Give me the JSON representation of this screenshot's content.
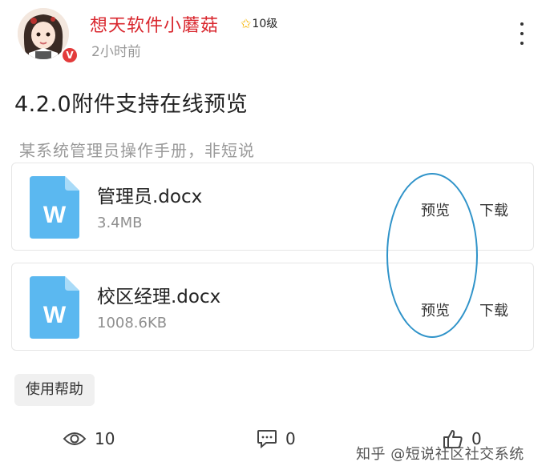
{
  "header": {
    "username": "想天软件小蘑菇",
    "level": "10级",
    "time_ago": "2小时前",
    "verified_mark": "V"
  },
  "post": {
    "title": "4.2.0附件支持在线预览",
    "description": "某系统管理员操作手册，非短说"
  },
  "attachments": [
    {
      "name": "管理员.docx",
      "size": "3.4MB",
      "icon_letter": "W",
      "preview_label": "预览",
      "download_label": "下载"
    },
    {
      "name": "校区经理.docx",
      "size": "1008.6KB",
      "icon_letter": "W",
      "preview_label": "预览",
      "download_label": "下载"
    }
  ],
  "tag": {
    "label": "使用帮助"
  },
  "stats": {
    "views": "10",
    "comments": "0",
    "likes": "0"
  },
  "watermark": "知乎 @短说社区社交系统",
  "colors": {
    "username": "#d9272e",
    "doc_icon": "#5bb8f0",
    "annotation": "#2f93c9"
  }
}
